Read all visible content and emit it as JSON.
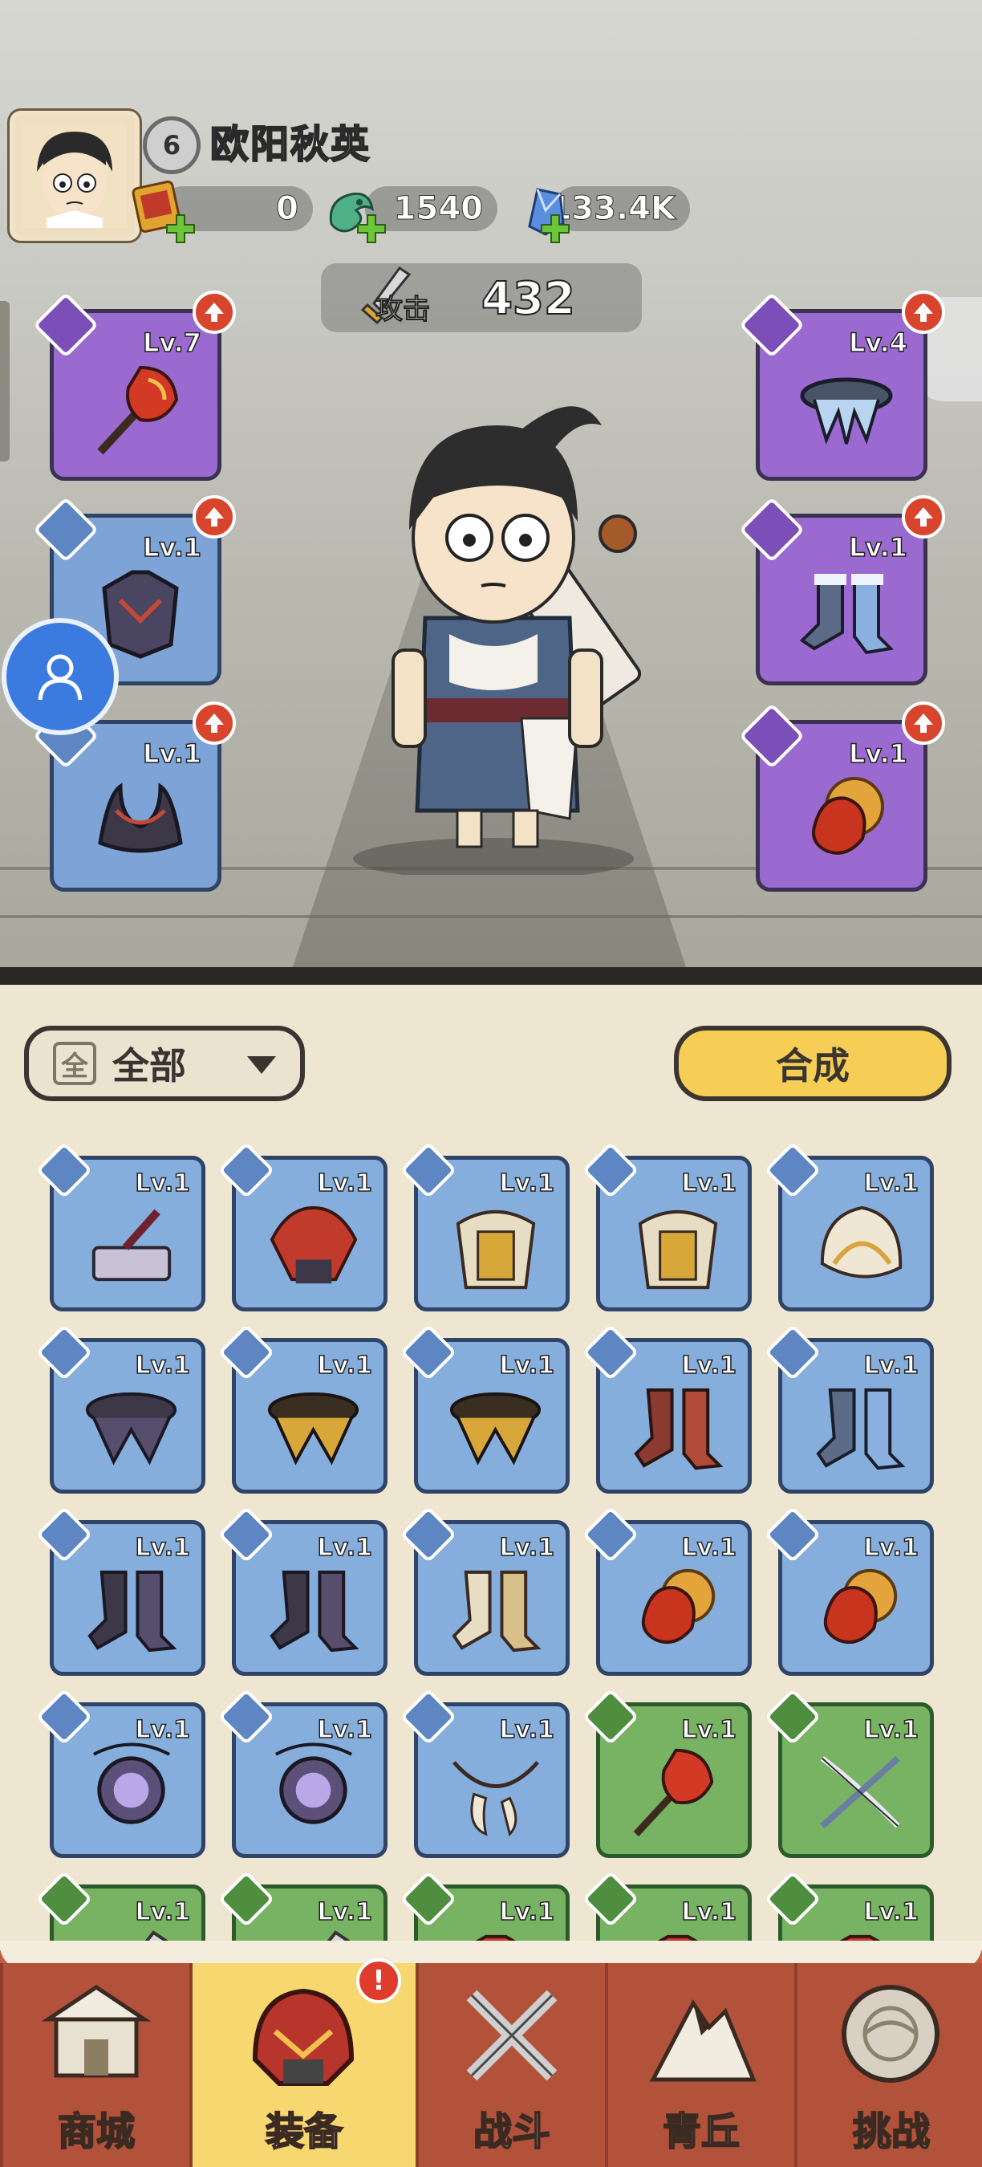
{
  "player": {
    "level": "6",
    "name": "欧阳秋英"
  },
  "currencies": [
    {
      "icon": "scroll-ticket-icon",
      "value": "0"
    },
    {
      "icon": "jade-dragon-icon",
      "value": "1540"
    },
    {
      "icon": "blue-crystal-icon",
      "value": "133.4K"
    }
  ],
  "attack": {
    "label": "攻击",
    "value": "432"
  },
  "equipped": {
    "left": [
      {
        "slot": "weapon",
        "level": "Lv.7",
        "rarity": "purple",
        "art": "flame-mace-icon"
      },
      {
        "slot": "armor",
        "level": "Lv.1",
        "rarity": "blue",
        "art": "dark-armor-icon"
      },
      {
        "slot": "helmet",
        "level": "Lv.1",
        "rarity": "blue",
        "art": "horned-crown-icon"
      }
    ],
    "right": [
      {
        "slot": "belt",
        "level": "Lv.4",
        "rarity": "purple",
        "art": "frost-belt-icon"
      },
      {
        "slot": "boots",
        "level": "Lv.1",
        "rarity": "purple",
        "art": "frost-boots-icon"
      },
      {
        "slot": "accessory",
        "level": "Lv.1",
        "rarity": "purple",
        "art": "flame-orb-icon"
      }
    ]
  },
  "filter": {
    "icon_char": "全",
    "label": "全部"
  },
  "compose_button": "合成",
  "inventory": [
    {
      "level": "Lv.1",
      "rarity": "blue",
      "art": "anvil-hammer-icon"
    },
    {
      "level": "Lv.1",
      "rarity": "blue",
      "art": "crimson-helm-icon"
    },
    {
      "level": "Lv.1",
      "rarity": "blue",
      "art": "golden-armor-icon"
    },
    {
      "level": "Lv.1",
      "rarity": "blue",
      "art": "golden-armor-icon"
    },
    {
      "level": "Lv.1",
      "rarity": "blue",
      "art": "feather-helm-icon"
    },
    {
      "level": "Lv.1",
      "rarity": "blue",
      "art": "dark-belt-icon"
    },
    {
      "level": "Lv.1",
      "rarity": "blue",
      "art": "golden-belt-icon"
    },
    {
      "level": "Lv.1",
      "rarity": "blue",
      "art": "golden-belt-icon"
    },
    {
      "level": "Lv.1",
      "rarity": "blue",
      "art": "red-boots-icon"
    },
    {
      "level": "Lv.1",
      "rarity": "blue",
      "art": "frost-boots-icon"
    },
    {
      "level": "Lv.1",
      "rarity": "blue",
      "art": "dark-boots-icon"
    },
    {
      "level": "Lv.1",
      "rarity": "blue",
      "art": "dark-boots-icon"
    },
    {
      "level": "Lv.1",
      "rarity": "blue",
      "art": "golden-boots-icon"
    },
    {
      "level": "Lv.1",
      "rarity": "blue",
      "art": "flame-orb-icon"
    },
    {
      "level": "Lv.1",
      "rarity": "blue",
      "art": "flame-orb-icon"
    },
    {
      "level": "Lv.1",
      "rarity": "blue",
      "art": "void-amulet-icon"
    },
    {
      "level": "Lv.1",
      "rarity": "blue",
      "art": "void-amulet-icon"
    },
    {
      "level": "Lv.1",
      "rarity": "blue",
      "art": "tooth-necklace-icon"
    },
    {
      "level": "Lv.1",
      "rarity": "green",
      "art": "flame-mace-icon"
    },
    {
      "level": "Lv.1",
      "rarity": "green",
      "art": "crossbow-icon"
    },
    {
      "level": "Lv.1",
      "rarity": "green",
      "art": "sword-icon"
    },
    {
      "level": "Lv.1",
      "rarity": "green",
      "art": "sword-icon"
    },
    {
      "level": "Lv.1",
      "rarity": "green",
      "art": "armor-icon"
    },
    {
      "level": "Lv.1",
      "rarity": "green",
      "art": "armor-icon"
    },
    {
      "level": "Lv.1",
      "rarity": "green",
      "art": "armor-icon"
    }
  ],
  "nav": [
    {
      "label": "商城",
      "icon": "shop-icon"
    },
    {
      "label": "装备",
      "icon": "equipment-helm-icon",
      "badge": "!"
    },
    {
      "label": "战斗",
      "icon": "crossed-swords-icon"
    },
    {
      "label": "青丘",
      "icon": "mountain-icon"
    },
    {
      "label": "挑战",
      "icon": "challenge-orb-icon"
    }
  ],
  "colors": {
    "purple_rarity": "#9b6ad0",
    "blue_rarity": "#86aedd",
    "green_rarity": "#78b363",
    "compose_button": "#f6cd55",
    "nav_bar": "#c45d42",
    "nav_active": "#f7d770",
    "side_button": "#3b7be0"
  }
}
